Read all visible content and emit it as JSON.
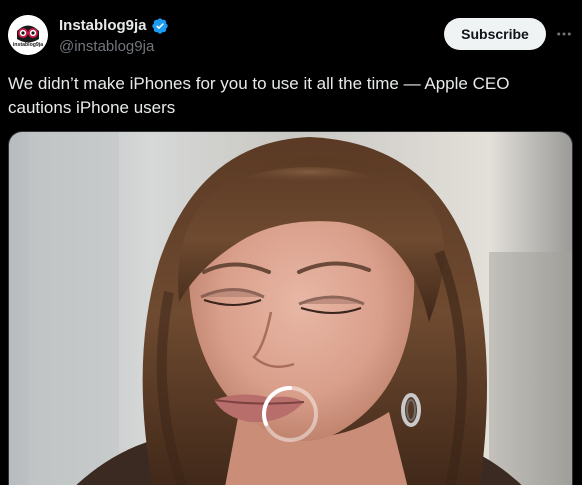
{
  "post": {
    "author": {
      "display_name": "Instablog9ja",
      "handle": "@instablog9ja",
      "verified": true,
      "avatar_text": "instablog9ja"
    },
    "subscribe_label": "Subscribe",
    "more_icon": "more-horizontal-icon",
    "text": "We didn’t make iPhones for you to use it all the time — Apple CEO cautions iPhone users",
    "media": {
      "type": "video",
      "state": "loading"
    }
  },
  "colors": {
    "background": "#000000",
    "text_primary": "#e7e9ea",
    "text_secondary": "#71767b",
    "verified_badge": "#1d9bf0",
    "subscribe_bg": "#eff3f4"
  }
}
